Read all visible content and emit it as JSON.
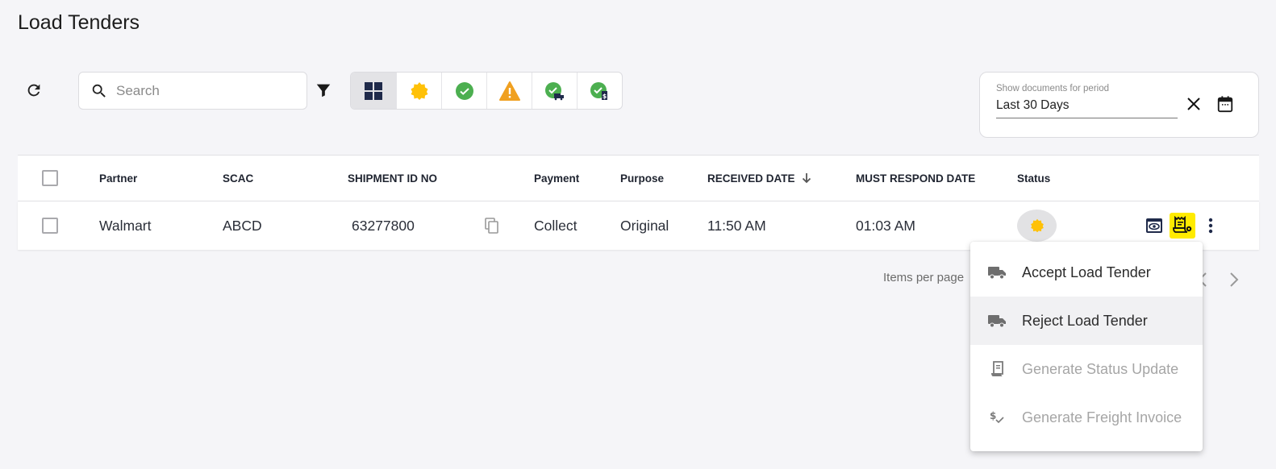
{
  "page": {
    "title": "Load Tenders"
  },
  "toolbar": {
    "refresh_icon": "refresh-icon",
    "search": {
      "placeholder": "Search",
      "value": ""
    },
    "filter_icon": "filter-icon",
    "status_filters": [
      {
        "name": "all",
        "icon": "grid-icon",
        "selected": true
      },
      {
        "name": "pending",
        "icon": "pending-badge-icon",
        "color": "#FFC107"
      },
      {
        "name": "accepted",
        "icon": "check-circle-icon",
        "color": "#4CAF50"
      },
      {
        "name": "warning",
        "icon": "warning-icon",
        "color": "#F0A020"
      },
      {
        "name": "status-update-sent",
        "icon": "check-truck-icon",
        "color": "#4CAF50"
      },
      {
        "name": "invoice-sent",
        "icon": "check-invoice-icon",
        "color": "#4CAF50"
      }
    ],
    "period": {
      "label": "Show documents for period",
      "value": "Last 30 Days"
    }
  },
  "table": {
    "columns": [
      "Partner",
      "SCAC",
      "SHIPMENT ID NO",
      "Payment",
      "Purpose",
      "RECEIVED DATE",
      "MUST RESPOND DATE",
      "Status"
    ],
    "sort": {
      "column": "RECEIVED DATE",
      "direction": "desc"
    },
    "rows": [
      {
        "partner": "Walmart",
        "scac": "ABCD",
        "shipment_id": "63277800",
        "payment": "Collect",
        "purpose": "Original",
        "received_date": "11:50 AM",
        "must_respond_date": "01:03 AM",
        "status": "pending"
      }
    ]
  },
  "pagination": {
    "items_per_page_label": "Items per page"
  },
  "context_menu": {
    "items": [
      {
        "label": "Accept Load Tender",
        "icon": "truck-icon",
        "disabled": false
      },
      {
        "label": "Reject Load Tender",
        "icon": "truck-icon",
        "disabled": false,
        "hovered": true
      },
      {
        "label": "Generate Status Update",
        "icon": "receipt-icon",
        "disabled": true
      },
      {
        "label": "Generate Freight Invoice",
        "icon": "dollar-check-icon",
        "disabled": true
      }
    ]
  },
  "colors": {
    "pending": "#FFC107",
    "success": "#4CAF50",
    "warning": "#F0A020",
    "highlight": "#FFEB00",
    "navy": "#1F2A4A"
  }
}
